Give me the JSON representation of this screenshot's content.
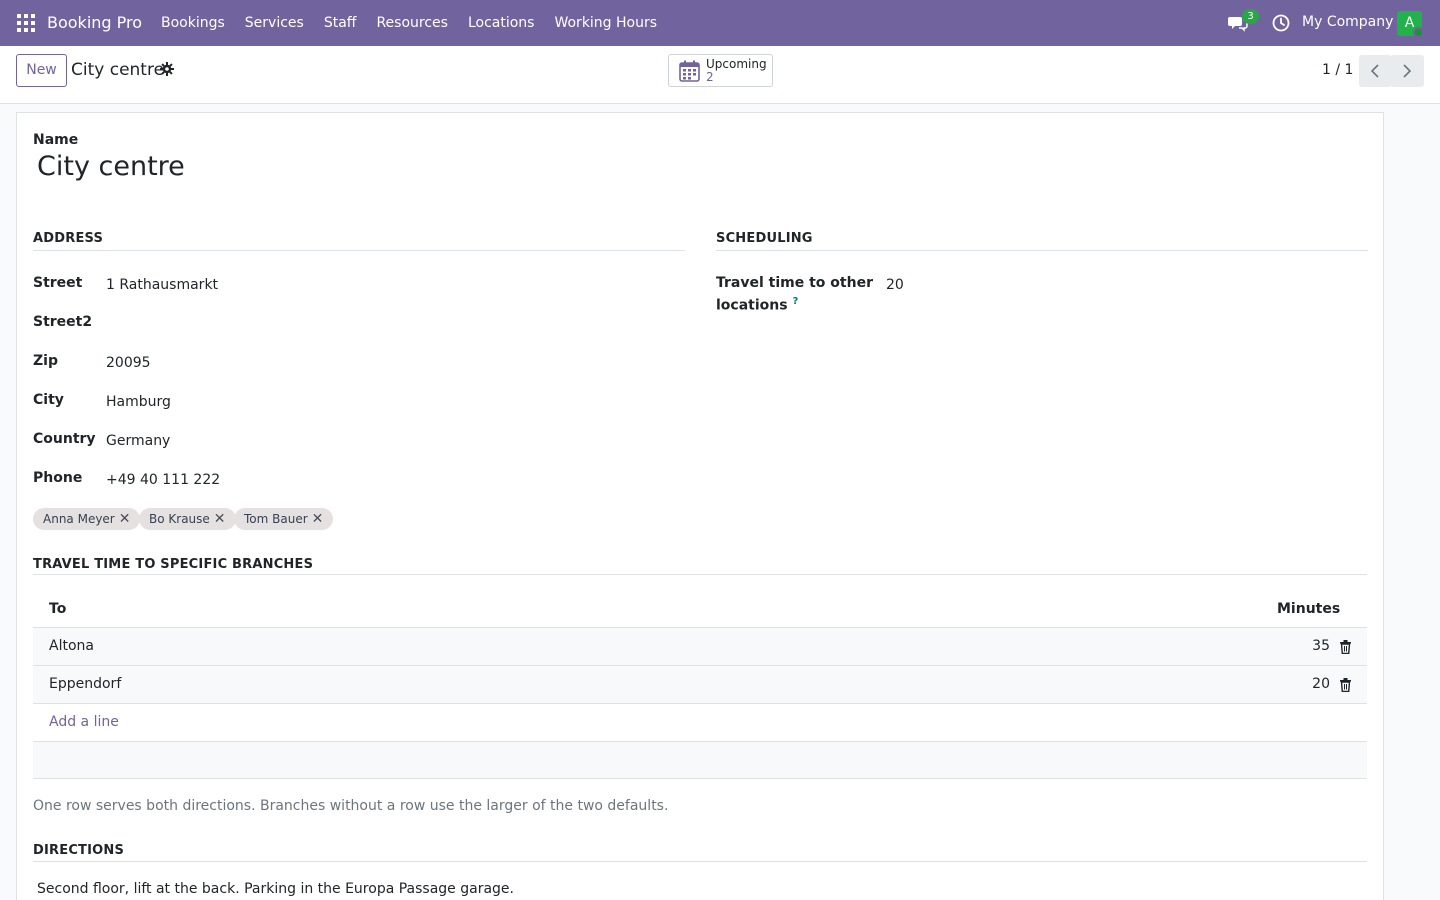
{
  "navbar": {
    "brand": "Booking Pro",
    "menu": [
      "Bookings",
      "Services",
      "Staff",
      "Resources",
      "Locations",
      "Working Hours"
    ],
    "messages_count": "3",
    "company": "My Company",
    "avatar_initial": "A",
    "accent_color": "#71639e"
  },
  "control_panel": {
    "new_label": "New",
    "title": "City centre",
    "smart_button": {
      "label": "Upcoming",
      "value": "2"
    },
    "pager": "1 / 1"
  },
  "form": {
    "name_label": "Name",
    "name_value": "City centre",
    "address": {
      "heading": "ADDRESS",
      "fields": [
        {
          "label": "Street",
          "value": "1 Rathausmarkt"
        },
        {
          "label": "Street2",
          "value": ""
        },
        {
          "label": "Zip",
          "value": "20095"
        },
        {
          "label": "City",
          "value": "Hamburg"
        },
        {
          "label": "Country",
          "value": "Germany"
        },
        {
          "label": "Phone",
          "value": "+49 40 111 222"
        }
      ]
    },
    "scheduling": {
      "heading": "SCHEDULING",
      "travel_label_line1": "Travel time to other",
      "travel_label_line2": "locations",
      "help_mark": "?",
      "travel_value": "20"
    },
    "tags": [
      "Anna Meyer",
      "Bo Krause",
      "Tom Bauer"
    ],
    "tag_remove_glyph": "✕",
    "travel_section": {
      "heading": "TRAVEL TIME TO SPECIFIC BRANCHES",
      "col_to": "To",
      "col_minutes": "Minutes",
      "rows": [
        {
          "to": "Altona",
          "minutes": "35"
        },
        {
          "to": "Eppendorf",
          "minutes": "20"
        }
      ],
      "add_line": "Add a line",
      "help": "One row serves both directions. Branches without a row use the larger of the two defaults."
    },
    "directions": {
      "heading": "DIRECTIONS",
      "text": "Second floor, lift at the back. Parking in the Europa Passage garage."
    }
  }
}
